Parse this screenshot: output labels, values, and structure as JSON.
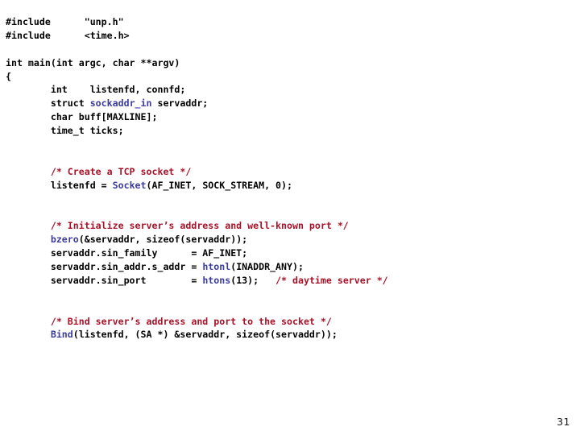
{
  "slide": {
    "page_number": "31",
    "background_color": "#ffffff",
    "colors": {
      "plain": "#000000",
      "comment": "#a81228",
      "function": "#3b3b9e",
      "type": "#3b3b9e"
    }
  },
  "code": {
    "language": "c",
    "lines": [
      {
        "id": "l01",
        "segments": [
          {
            "kind": "plain",
            "text": "#include      \"unp.h\""
          }
        ]
      },
      {
        "id": "l02",
        "segments": [
          {
            "kind": "plain",
            "text": "#include      <time.h>"
          }
        ]
      },
      {
        "id": "l03",
        "segments": []
      },
      {
        "id": "l04",
        "segments": [
          {
            "kind": "plain",
            "text": "int main(int argc, char **argv)"
          }
        ]
      },
      {
        "id": "l05",
        "segments": [
          {
            "kind": "plain",
            "text": "{"
          }
        ]
      },
      {
        "id": "l06",
        "segments": [
          {
            "kind": "plain",
            "text": "        int    listenfd, connfd;"
          }
        ]
      },
      {
        "id": "l07",
        "segments": [
          {
            "kind": "plain",
            "text": "        struct "
          },
          {
            "kind": "type",
            "text": "sockaddr_in"
          },
          {
            "kind": "plain",
            "text": " servaddr;"
          }
        ]
      },
      {
        "id": "l08",
        "segments": [
          {
            "kind": "plain",
            "text": "        char buff[MAXLINE];"
          }
        ]
      },
      {
        "id": "l09",
        "segments": [
          {
            "kind": "plain",
            "text": "        time_t ticks;"
          }
        ]
      },
      {
        "id": "l10",
        "segments": []
      },
      {
        "id": "l11",
        "segments": []
      },
      {
        "id": "l12",
        "segments": [
          {
            "kind": "comment",
            "text": "        /* Create a TCP socket */"
          }
        ]
      },
      {
        "id": "l13",
        "segments": [
          {
            "kind": "plain",
            "text": "        listenfd = "
          },
          {
            "kind": "func",
            "text": "Socket"
          },
          {
            "kind": "plain",
            "text": "(AF_INET, SOCK_STREAM, 0);"
          }
        ]
      },
      {
        "id": "l14",
        "segments": []
      },
      {
        "id": "l15",
        "segments": []
      },
      {
        "id": "l16",
        "segments": [
          {
            "kind": "comment",
            "text": "        /* Initialize server’s address and well-known port */"
          }
        ]
      },
      {
        "id": "l17",
        "segments": [
          {
            "kind": "plain",
            "text": "        "
          },
          {
            "kind": "func",
            "text": "bzero"
          },
          {
            "kind": "plain",
            "text": "(&servaddr, sizeof(servaddr));"
          }
        ]
      },
      {
        "id": "l18",
        "segments": [
          {
            "kind": "plain",
            "text": "        servaddr.sin_family      = AF_INET;"
          }
        ]
      },
      {
        "id": "l19",
        "segments": [
          {
            "kind": "plain",
            "text": "        servaddr.sin_addr.s_addr = "
          },
          {
            "kind": "func",
            "text": "htonl"
          },
          {
            "kind": "plain",
            "text": "(INADDR_ANY);"
          }
        ]
      },
      {
        "id": "l20",
        "segments": [
          {
            "kind": "plain",
            "text": "        servaddr.sin_port        = "
          },
          {
            "kind": "func",
            "text": "htons"
          },
          {
            "kind": "plain",
            "text": "(13);   "
          },
          {
            "kind": "comment",
            "text": "/* daytime server */"
          }
        ]
      },
      {
        "id": "l21",
        "segments": []
      },
      {
        "id": "l22",
        "segments": []
      },
      {
        "id": "l23",
        "segments": [
          {
            "kind": "comment",
            "text": "        /* Bind server’s address and port to the socket */"
          }
        ]
      },
      {
        "id": "l24",
        "segments": [
          {
            "kind": "plain",
            "text": "        "
          },
          {
            "kind": "func",
            "text": "Bind"
          },
          {
            "kind": "plain",
            "text": "(listenfd, (SA *) &servaddr, sizeof(servaddr));"
          }
        ]
      }
    ]
  }
}
